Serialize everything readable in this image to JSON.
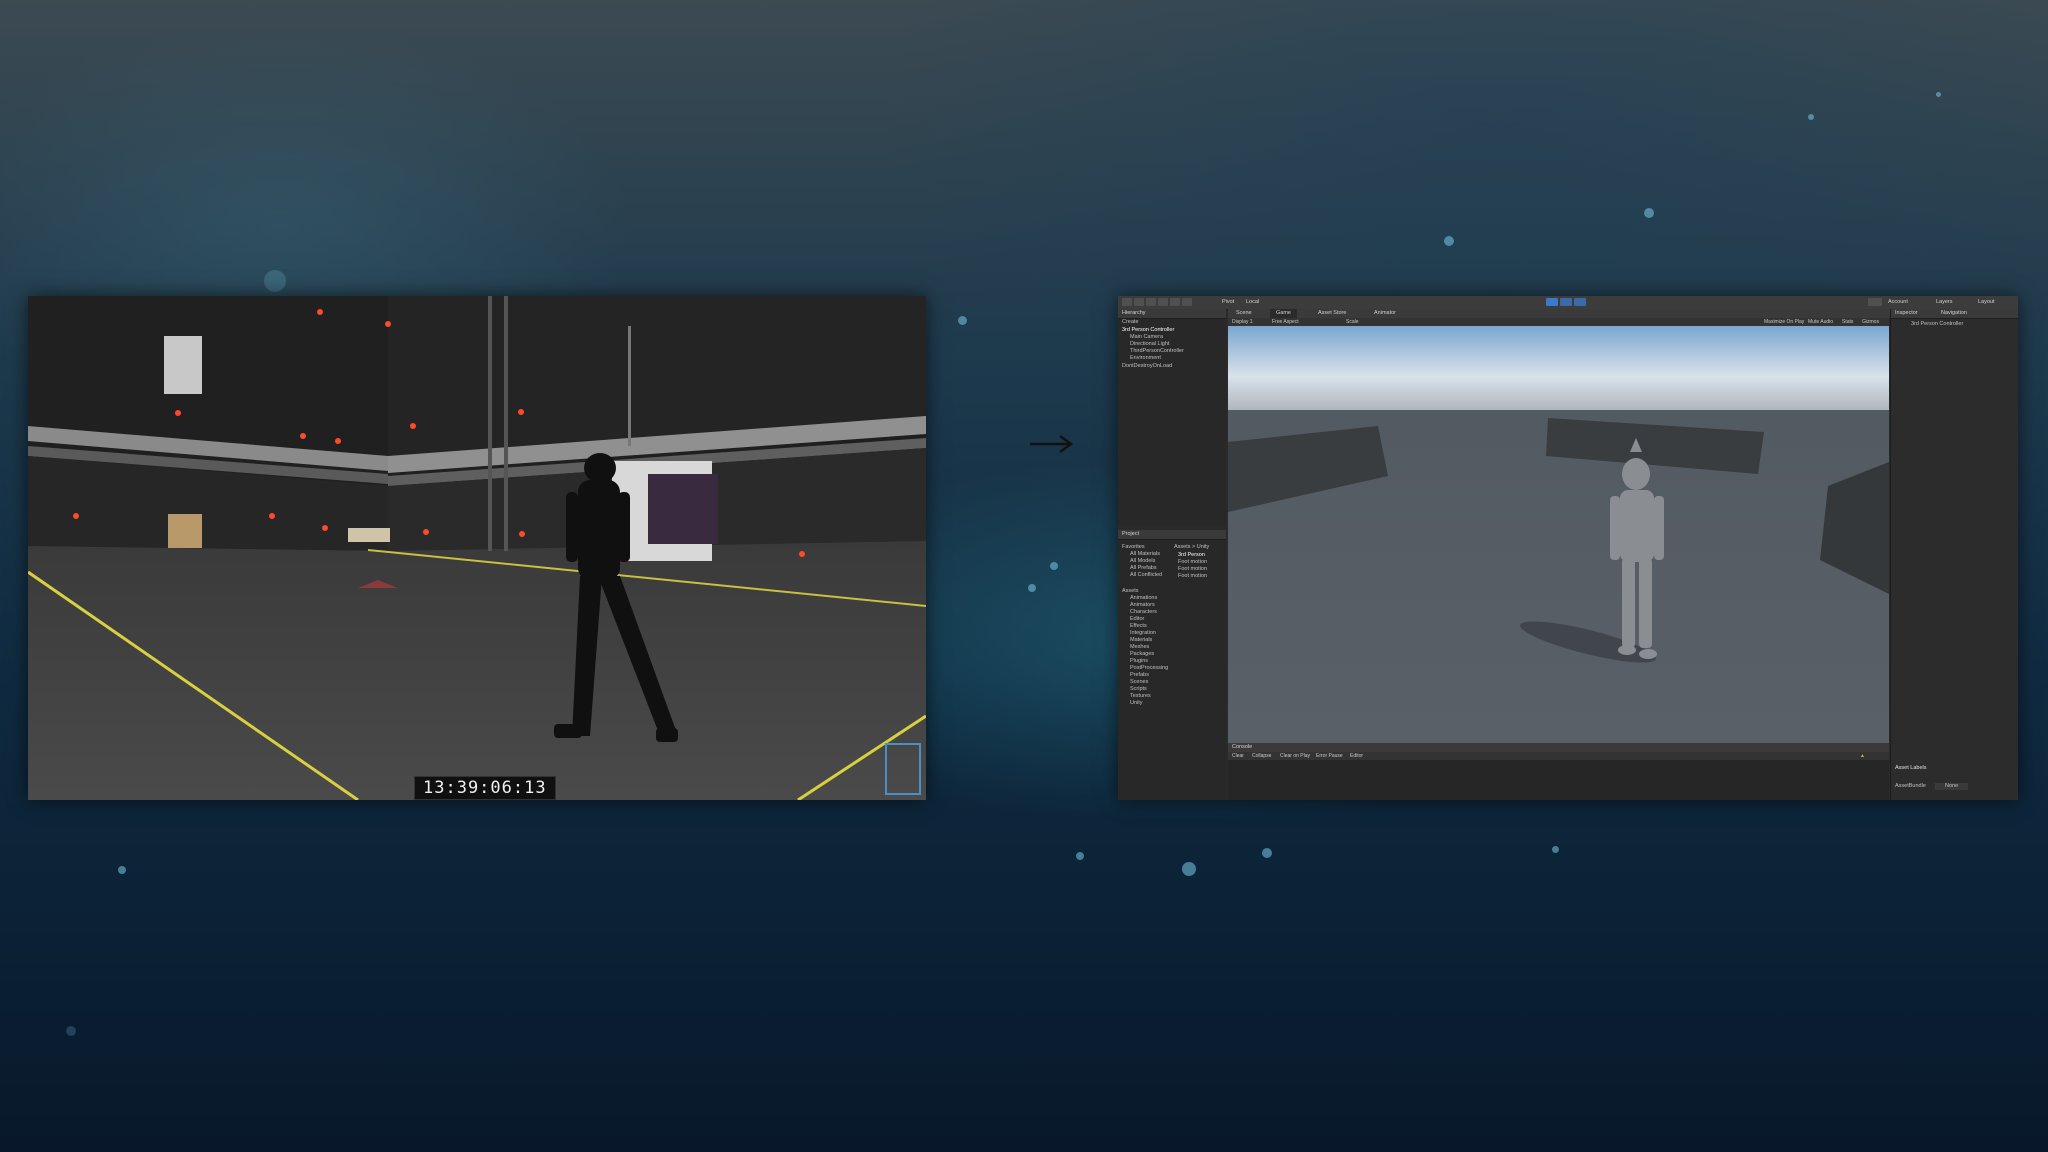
{
  "video": {
    "timecode": "13:39:06:13"
  },
  "editor": {
    "toolbar": {
      "pivot_label": "Pivot",
      "local_label": "Local",
      "account_label": "Account",
      "layers_label": "Layers",
      "layout_label": "Layout"
    },
    "hierarchy": {
      "title": "Hierarchy",
      "create_label": "Create",
      "rows": [
        "3rd Person Controller",
        "Main Camera",
        "Directional Light",
        "ThirdPersonController",
        "Environment",
        "DontDestroyOnLoad"
      ]
    },
    "game_tabs": [
      "Scene",
      "Game",
      "Asset Store",
      "Animator"
    ],
    "game_options": {
      "display": "Display 1",
      "aspect": "Free Aspect",
      "scale": "Scale",
      "maximize": "Maximize On Play",
      "mute": "Mute Audio",
      "stats": "Stats",
      "gizmos": "Gizmos"
    },
    "project": {
      "title": "Project",
      "favorites_label": "Favorites",
      "favorites": [
        "All Materials",
        "All Models",
        "All Prefabs",
        "All Conflicted"
      ],
      "assets_label": "Assets",
      "assets": [
        "Animations",
        "Animators",
        "Characters",
        "Editor",
        "Effects",
        "Integration",
        "Materials",
        "Meshes",
        "Packages",
        "Plugins",
        "PostProcessing",
        "Prefabs",
        "Scenes",
        "Scripts",
        "Textures",
        "Unity"
      ],
      "breadcrumb": "Assets > Unity",
      "files": [
        "3rd Person",
        "Foot motion",
        "Foot motion",
        "Foot motion"
      ]
    },
    "console": {
      "title": "Console",
      "buttons": [
        "Clear",
        "Collapse",
        "Clear on Play",
        "Error Pause",
        "Editor"
      ]
    },
    "inspector": {
      "tabs": [
        "Inspector",
        "Navigation"
      ],
      "object_name": "3rd Person Controller",
      "asset_labels": "Asset Labels",
      "asset_bundle": "AssetBundle",
      "bundle_value": "None"
    }
  }
}
